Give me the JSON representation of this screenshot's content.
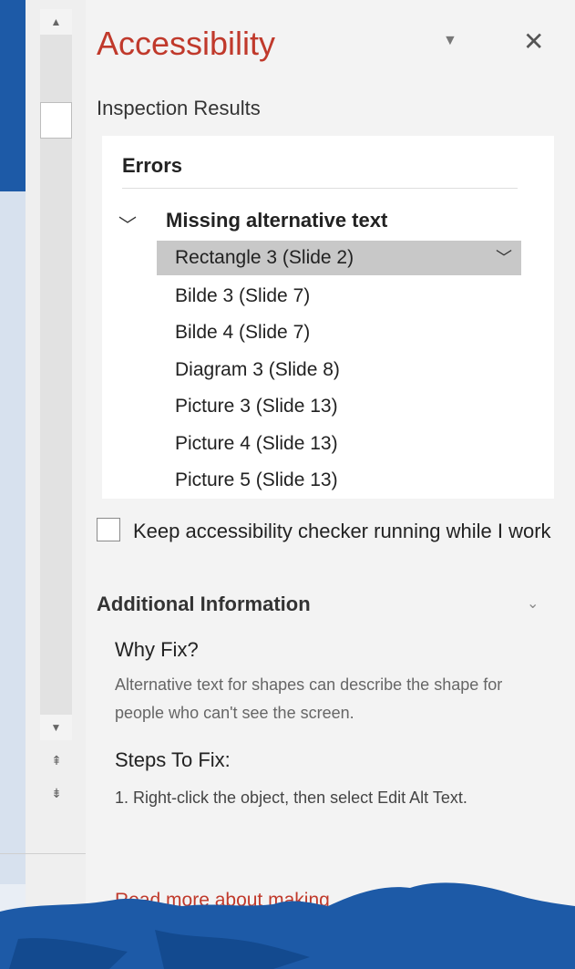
{
  "pane": {
    "title": "Accessibility",
    "menu_icon": "chevron-down-icon",
    "close_icon": "close-icon",
    "close_glyph": "✕",
    "inspection_label": "Inspection Results"
  },
  "errors": {
    "heading": "Errors",
    "groups": [
      {
        "title": "Missing alternative text",
        "items": [
          {
            "label": "Rectangle 3  (Slide 2)",
            "selected": true
          },
          {
            "label": "Bilde 3  (Slide 7)"
          },
          {
            "label": "Bilde 4  (Slide 7)"
          },
          {
            "label": "Diagram 3  (Slide 8)"
          },
          {
            "label": "Picture 3  (Slide 13)"
          },
          {
            "label": "Picture 4  (Slide 13)"
          },
          {
            "label": "Picture 5  (Slide 13)"
          }
        ]
      }
    ]
  },
  "options": {
    "keep_running_label": "Keep accessibility checker running while I work",
    "keep_running_checked": false
  },
  "additional": {
    "heading": "Additional Information",
    "why_heading": "Why Fix?",
    "why_text": "Alternative text for shapes can describe the shape for people who can't see the screen.",
    "steps_heading": "Steps To Fix:",
    "steps_text": "1. Right-click the object, then select Edit Alt Text.",
    "read_more_link": "Read more about making"
  },
  "colors": {
    "accent": "#c0392b",
    "slide_blue": "#1d5aa7",
    "selected_row": "#c8c8c8"
  }
}
